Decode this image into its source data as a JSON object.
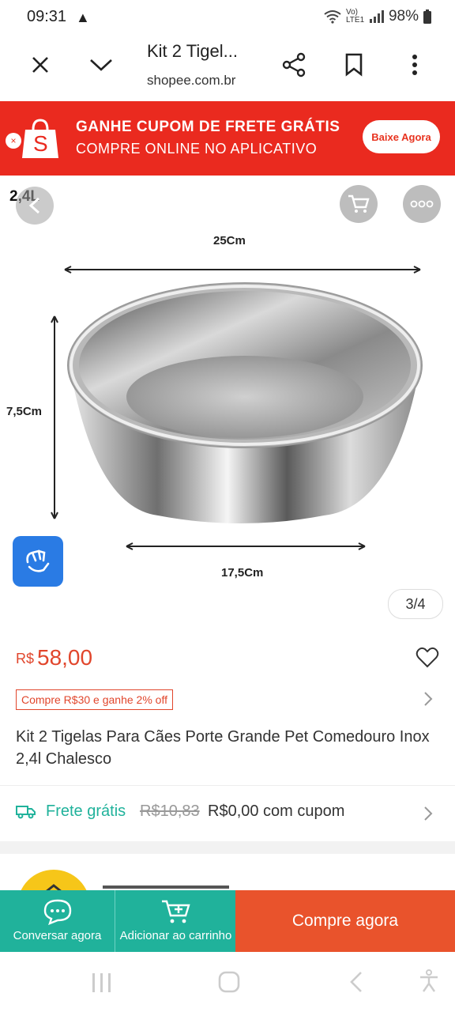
{
  "status_bar": {
    "time": "09:31",
    "alert_icon": "warning-icon",
    "network": "Vo) LTE1",
    "battery": "98%"
  },
  "toolbar": {
    "title": "Kit 2 Tigel...",
    "domain": "shopee.com.br",
    "icons": [
      "close-icon",
      "chevron-down-icon",
      "share-icon",
      "bookmark-icon",
      "more-vert-icon"
    ]
  },
  "banner": {
    "line1": "GANHE CUPOM DE FRETE GRÁTIS",
    "line2": "COMPRE ONLINE NO APLICATIVO",
    "cta": "Baixe Agora",
    "close_glyph": "×",
    "logo_letter": "S",
    "color": "#ea2a1f"
  },
  "product_image": {
    "capacity_label": "2,4L",
    "width_label": "25Cm",
    "height_label": "7,5Cm",
    "base_label": "17,5Cm",
    "counter": "3/4"
  },
  "price": {
    "currency": "R$",
    "value": "58,00",
    "color": "#e1462c"
  },
  "promo": {
    "text": "Compre R$30 e ganhe 2% off"
  },
  "product": {
    "title": "Kit 2 Tigelas Para Cães Porte Grande Pet Comedouro Inox 2,4l Chalesco"
  },
  "shipping": {
    "label": "Frete grátis",
    "old_price": "R$10,83",
    "new_price": "R$0,00 com cupom"
  },
  "bottom_bar": {
    "chat_label": "Conversar agora",
    "cart_label": "Adicionar ao carrinho",
    "buy_label": "Compre agora",
    "accent": "#20b29b",
    "buy_color": "#e9532c"
  }
}
